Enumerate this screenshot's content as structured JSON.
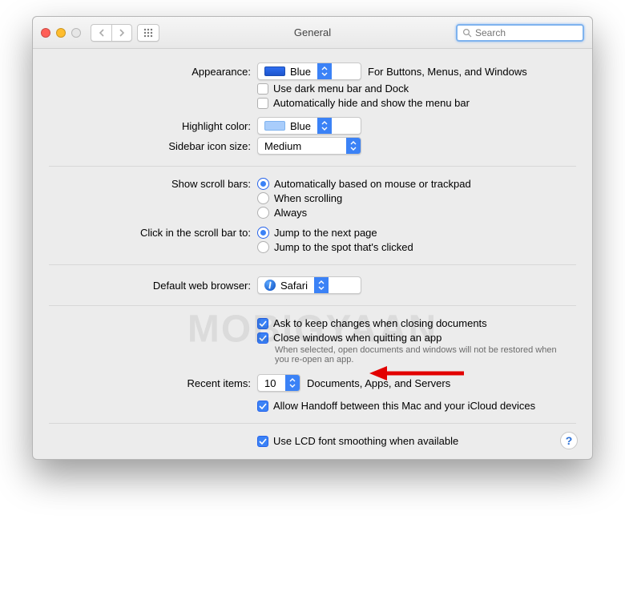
{
  "window": {
    "title": "General"
  },
  "search": {
    "placeholder": "Search"
  },
  "labels": {
    "appearance": "Appearance:",
    "highlight_color": "Highlight color:",
    "sidebar_icon_size": "Sidebar icon size:",
    "show_scroll_bars": "Show scroll bars:",
    "click_scroll_bar": "Click in the scroll bar to:",
    "default_browser": "Default web browser:",
    "recent_items": "Recent items:"
  },
  "values": {
    "appearance": "Blue",
    "appearance_note": "For Buttons, Menus, and Windows",
    "highlight_color": "Blue",
    "sidebar_icon_size": "Medium",
    "default_browser": "Safari",
    "recent_items": "10",
    "recent_items_note": "Documents, Apps, and Servers"
  },
  "checks": {
    "dark_menu": "Use dark menu bar and Dock",
    "auto_hide_menu": "Automatically hide and show the menu bar",
    "ask_keep_changes": "Ask to keep changes when closing documents",
    "close_windows_quit": "Close windows when quitting an app",
    "close_windows_note": "When selected, open documents and windows will not be restored when you re-open an app.",
    "allow_handoff": "Allow Handoff between this Mac and your iCloud devices",
    "lcd_font_smoothing": "Use LCD font smoothing when available"
  },
  "radios": {
    "scroll_auto": "Automatically based on mouse or trackpad",
    "scroll_when": "When scrolling",
    "scroll_always": "Always",
    "jump_next": "Jump to the next page",
    "jump_spot": "Jump to the spot that's clicked"
  },
  "watermark": "MOBIGYAAN"
}
